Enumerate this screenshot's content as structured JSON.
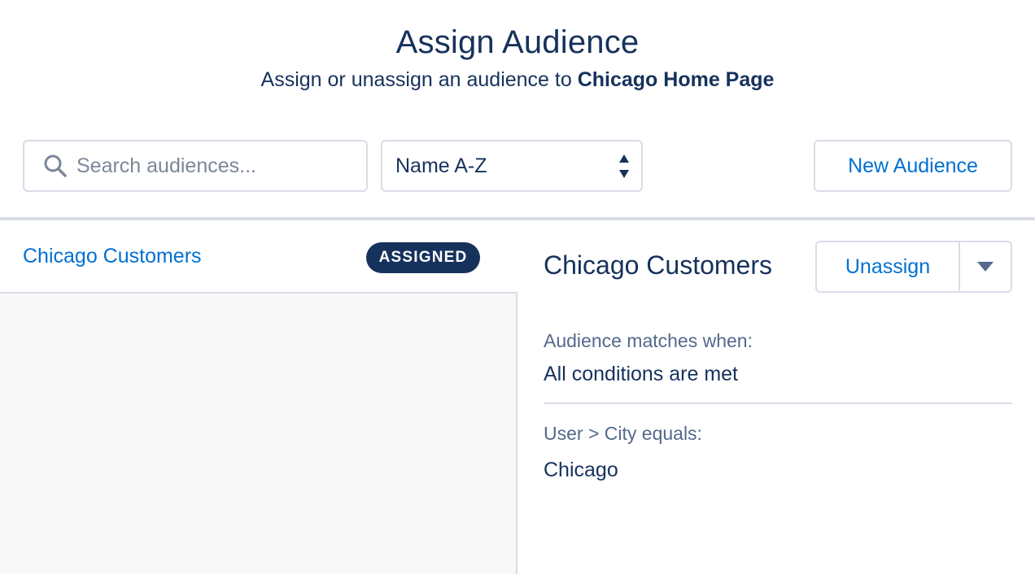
{
  "header": {
    "title": "Assign Audience",
    "subtitle_prefix": "Assign or unassign an audience to ",
    "subtitle_target": "Chicago Home Page"
  },
  "toolbar": {
    "search": {
      "placeholder": "Search audiences...",
      "value": "",
      "icon": "search-icon"
    },
    "sort": {
      "selected": "Name A-Z"
    },
    "new_audience_label": "New Audience"
  },
  "list": {
    "items": [
      {
        "name": "Chicago Customers",
        "badge": "ASSIGNED"
      }
    ]
  },
  "detail": {
    "title": "Chicago Customers",
    "unassign_label": "Unassign",
    "match_label": "Audience matches when:",
    "match_value": "All conditions are met",
    "condition_label": "User > City equals:",
    "condition_value": "Chicago"
  },
  "colors": {
    "brand_navy": "#16325c",
    "link_blue": "#0070d2",
    "muted_text": "#54698d",
    "border": "#d8dde6",
    "panel_bg": "#f8f8f8"
  }
}
